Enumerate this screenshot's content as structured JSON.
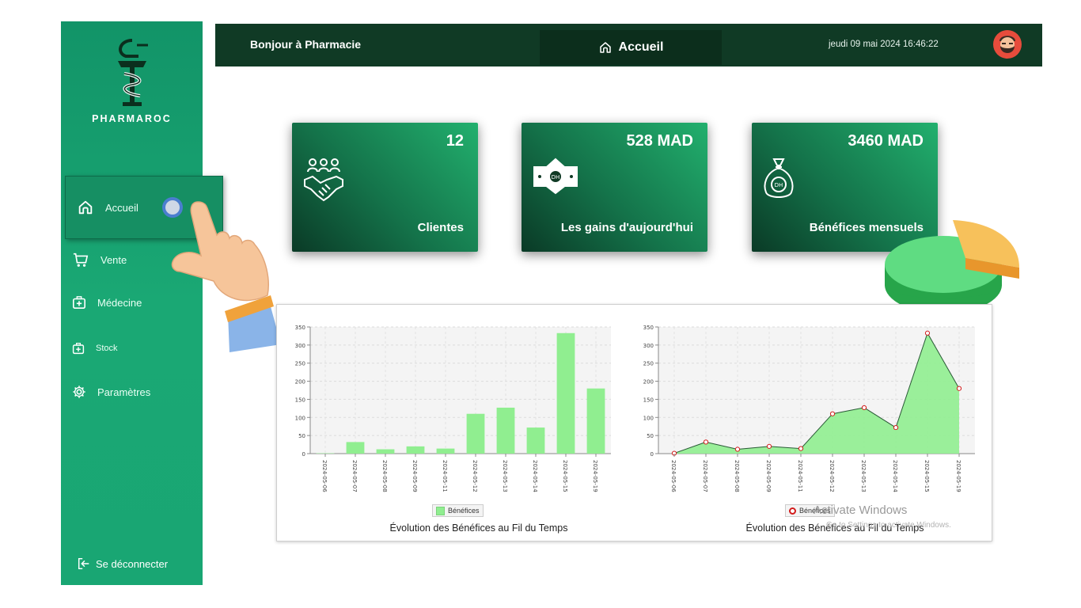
{
  "brand": {
    "name": "PHARMAROC"
  },
  "sidebar": {
    "items": [
      {
        "label": "Accueil",
        "icon": "home-icon",
        "active": true
      },
      {
        "label": "Vente",
        "icon": "cart-icon"
      },
      {
        "label": "Médecine",
        "icon": "medkit-icon"
      },
      {
        "label": "Stock",
        "icon": "medkit-icon"
      },
      {
        "label": "Paramètres",
        "icon": "gear-icon"
      }
    ],
    "logout_label": "Se déconnecter"
  },
  "header": {
    "greeting": "Bonjour à Pharmacie",
    "page_title": "Accueil",
    "datetime": "jeudi 09 mai 2024 16:46:22"
  },
  "cards": [
    {
      "value": "12",
      "label": "Clientes",
      "icon": "handshake-icon"
    },
    {
      "value": "528 MAD",
      "label": "Les gains d'aujourd'hui",
      "icon": "banknote-icon"
    },
    {
      "value": "3460 MAD",
      "label": "Bénéfices mensuels",
      "icon": "money-bag-icon"
    }
  ],
  "colors": {
    "sidebar": "#1aa874",
    "topbar": "#103a25",
    "series": "#90ee90",
    "marker": "#d21b1b"
  },
  "chart_data": [
    {
      "type": "bar",
      "title": "Évolution des Bénéfices au Fil du Temps",
      "categories": [
        "2024-05-06",
        "2024-05-07",
        "2024-05-08",
        "2024-05-09",
        "2024-05-11",
        "2024-05-12",
        "2024-05-13",
        "2024-05-14",
        "2024-05-15",
        "2024-05-19"
      ],
      "series": [
        {
          "name": "Bénéfices",
          "values": [
            1,
            32,
            12,
            20,
            14,
            110,
            127,
            72,
            333,
            180
          ]
        }
      ],
      "ylim": [
        0,
        350
      ],
      "yticks": [
        0,
        50,
        100,
        150,
        200,
        250,
        300,
        350
      ],
      "grid": true,
      "legend": "bottom"
    },
    {
      "type": "area",
      "title": "Évolution des Bénéfices au Fil du Temps",
      "categories": [
        "2024-05-06",
        "2024-05-07",
        "2024-05-08",
        "2024-05-09",
        "2024-05-11",
        "2024-05-12",
        "2024-05-13",
        "2024-05-14",
        "2024-05-15",
        "2024-05-19"
      ],
      "series": [
        {
          "name": "Bénéfices",
          "values": [
            1,
            32,
            12,
            20,
            14,
            110,
            127,
            72,
            333,
            180
          ]
        }
      ],
      "ylim": [
        0,
        350
      ],
      "yticks": [
        0,
        50,
        100,
        150,
        200,
        250,
        300,
        350
      ],
      "grid": true,
      "legend": "bottom"
    }
  ],
  "watermark": {
    "title": "Activate Windows",
    "subtitle": "Go to Settings to activate Windows."
  }
}
